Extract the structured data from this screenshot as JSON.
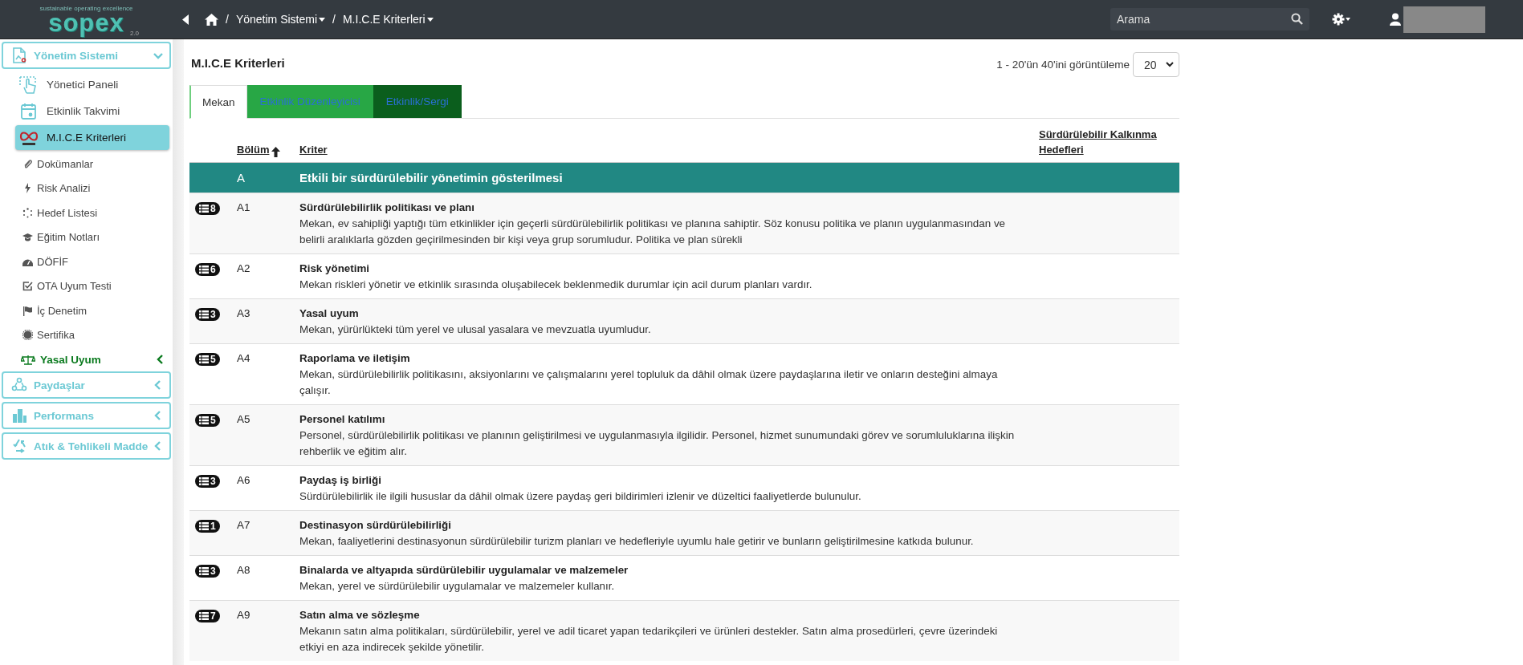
{
  "logo": {
    "tagline": "sustainable operating excellence",
    "name": "sopex",
    "version": "2.0"
  },
  "topbar": {
    "breadcrumb": [
      {
        "separator": "/",
        "label": "Yönetim Sistemi"
      },
      {
        "separator": "/",
        "label": "M.I.C.E Kriterleri"
      }
    ],
    "search": {
      "placeholder": "Arama"
    }
  },
  "sidebar": {
    "groups": [
      {
        "label": "Yönetim Sistemi",
        "expanded": true,
        "children": [
          {
            "kind": "page",
            "label": "Yönetici Paneli",
            "selected": false
          },
          {
            "kind": "page",
            "label": "Etkinlik Takvimi",
            "selected": false
          },
          {
            "kind": "page",
            "label": "M.I.C.E Kriterleri",
            "selected": true
          },
          {
            "kind": "link",
            "label": "Dokümanlar",
            "selected": false
          },
          {
            "kind": "link",
            "label": "Risk Analizi",
            "selected": false
          },
          {
            "kind": "link",
            "label": "Hedef Listesi",
            "selected": false
          },
          {
            "kind": "link",
            "label": "Eğitim Notları",
            "selected": false
          },
          {
            "kind": "link",
            "label": "DÖFİF",
            "selected": false
          },
          {
            "kind": "link",
            "label": "OTA Uyum Testi",
            "selected": false
          },
          {
            "kind": "link",
            "label": "İç Denetim",
            "selected": false
          },
          {
            "kind": "link",
            "label": "Sertifika",
            "selected": false
          },
          {
            "kind": "subgroup",
            "label": "Yasal Uyum",
            "selected": false,
            "expanded": false
          }
        ]
      },
      {
        "label": "Paydaşlar",
        "expanded": false
      },
      {
        "label": "Performans",
        "expanded": false
      },
      {
        "label": "Atık & Tehlikeli Madde",
        "expanded": false
      }
    ]
  },
  "page": {
    "title": "M.I.C.E Kriterleri",
    "pager": {
      "text": "1 - 20'ün 40'ini görüntüleme",
      "page_size": "20"
    },
    "tabs": [
      {
        "label": "Mekan",
        "selected": true,
        "color": "#ffffff"
      },
      {
        "label": "Etkinlik Düzenleyicisi",
        "selected": false,
        "color": "#28a745"
      },
      {
        "label": "Etkinlik/Sergi",
        "selected": false,
        "color": "#0b5e1d"
      }
    ],
    "table": {
      "columns": [
        {
          "label": "Bölüm",
          "sorted": true
        },
        {
          "label": "Kriter",
          "sorted": false
        },
        {
          "label": "Sürdürülebilir Kalkınma Hedefleri",
          "sorted": false
        }
      ],
      "sections": [
        {
          "code": "A",
          "title": "Etkili bir sürdürülebilir yönetimin gösterilmesi",
          "rows": [
            {
              "count": "8",
              "code": "A1",
              "title": "Sürdürülebilirlik politikası ve planı",
              "description": "Mekan, ev sahipliği yaptığı tüm etkinlikler için geçerli sürdürülebilirlik politikası ve planına sahiptir. Söz konusu politika ve planın uygulanmasından ve belirli aralıklarla gözden geçirilmesinden bir kişi veya grup sorumludur. Politika ve plan sürekli"
            },
            {
              "count": "6",
              "code": "A2",
              "title": "Risk yönetimi",
              "description": "Mekan riskleri yönetir ve etkinlik sırasında oluşabilecek beklenmedik durumlar için acil durum planları vardır."
            },
            {
              "count": "3",
              "code": "A3",
              "title": "Yasal uyum",
              "description": "Mekan, yürürlükteki tüm yerel ve ulusal yasalara ve mevzuatla uyumludur."
            },
            {
              "count": "5",
              "code": "A4",
              "title": "Raporlama ve iletişim",
              "description": "Mekan, sürdürülebilirlik politikasını, aksiyonlarını ve çalışmalarını yerel topluluk da dâhil olmak üzere paydaşlarına iletir ve onların desteğini almaya çalışır."
            },
            {
              "count": "5",
              "code": "A5",
              "title": "Personel katılımı",
              "description": "Personel, sürdürülebilirlik politikası ve planının geliştirilmesi ve uygulanmasıyla ilgilidir. Personel, hizmet sunumundaki görev ve sorumluluklarına ilişkin rehberlik ve eğitim alır."
            },
            {
              "count": "3",
              "code": "A6",
              "title": "Paydaş iş birliği",
              "description": "Sürdürülebilirlik ile ilgili hususlar da dâhil olmak üzere paydaş geri bildirimleri izlenir ve düzeltici faaliyetlerde bulunulur."
            },
            {
              "count": "1",
              "code": "A7",
              "title": "Destinasyon sürdürülebilirliği",
              "description": "Mekan, faaliyetlerini destinasyonun sürdürülebilir turizm planları ve hedefleriyle uyumlu hale getirir ve bunların geliştirilmesine katkıda bulunur."
            },
            {
              "count": "3",
              "code": "A8",
              "title": "Binalarda ve altyapıda sürdürülebilir uygulamalar ve malzemeler",
              "description": "Mekan, yerel ve sürdürülebilir uygulamalar ve malzemeler kullanır."
            },
            {
              "count": "7",
              "code": "A9",
              "title": "Satın alma ve sözleşme",
              "description": "Mekanın satın alma politikaları, sürdürülebilir, yerel ve adil ticaret yapan tedarikçileri ve ürünleri destekler. Satın alma prosedürleri, çevre üzerindeki etkiyi en aza indirecek şekilde yönetilir."
            }
          ]
        }
      ]
    }
  }
}
